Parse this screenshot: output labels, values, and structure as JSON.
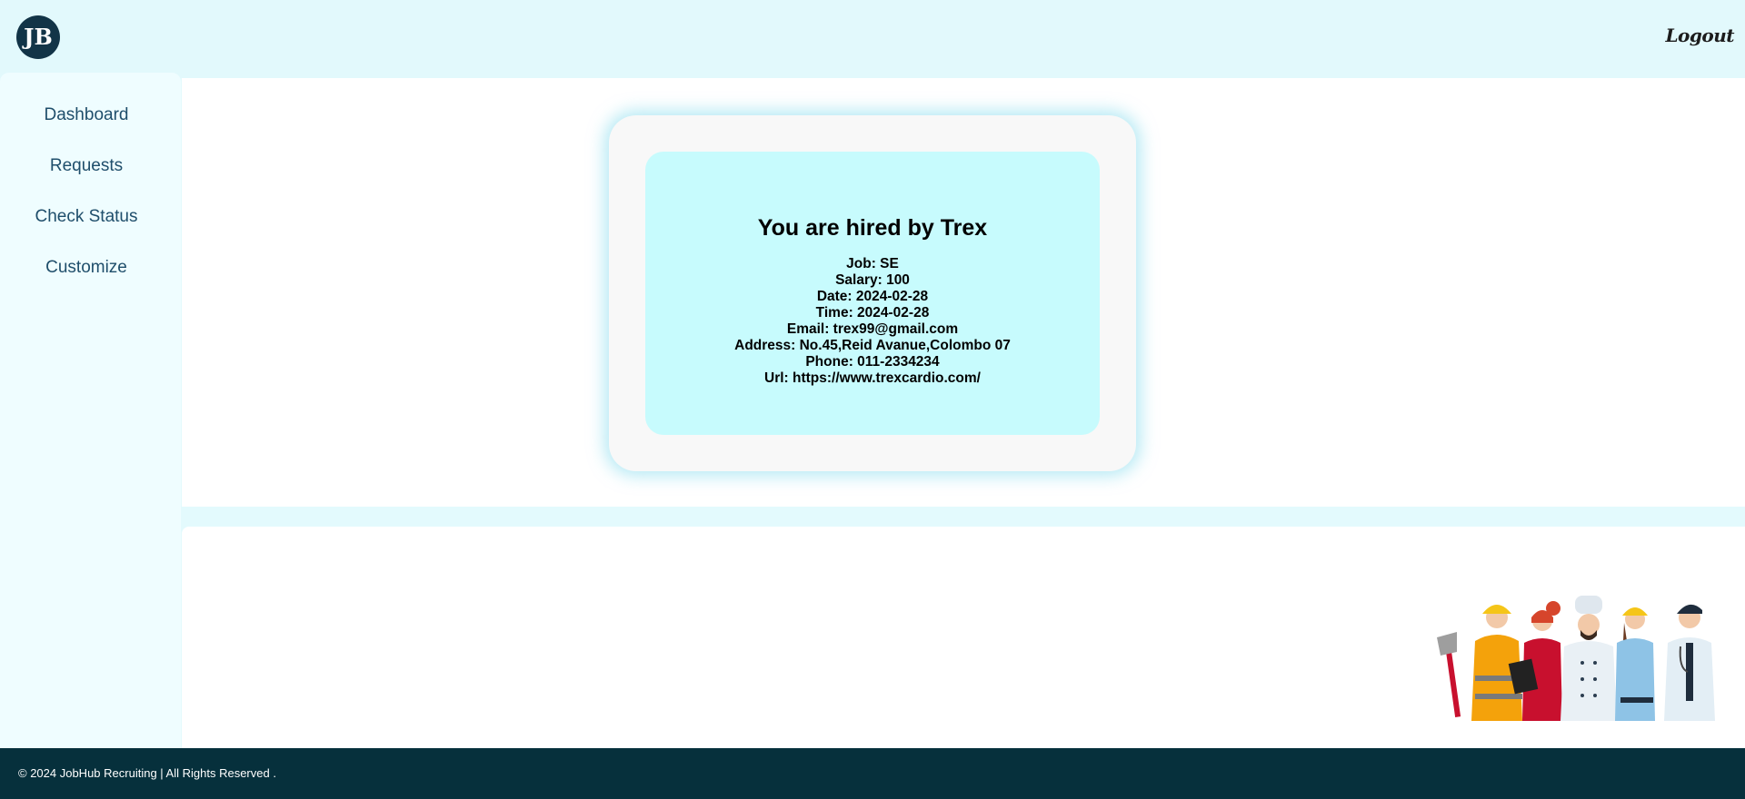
{
  "header": {
    "logo_text": "JB",
    "logout_label": "Logout"
  },
  "sidebar": {
    "items": [
      {
        "label": "Dashboard"
      },
      {
        "label": "Requests"
      },
      {
        "label": "Check Status"
      },
      {
        "label": "Customize"
      }
    ]
  },
  "hire_card": {
    "title": "You are hired by Trex",
    "details": [
      "Job: SE",
      "Salary: 100",
      "Date: 2024-02-28",
      "Time: 2024-02-28",
      "Email: trex99@gmail.com",
      "Address: No.45,Reid Avanue,Colombo 07",
      "Phone: 011-2334234",
      "Url: https://www.trexcardio.com/"
    ]
  },
  "illustration": {
    "icon": "workers-group-illustration"
  },
  "footer": {
    "text": "© 2024 JobHub Recruiting | All Rights Reserved ."
  },
  "colors": {
    "header_bg": "#e2f9fc",
    "sidebar_bg": "#effdff",
    "nav_text": "#1f4e6b",
    "card_outer": "#f8f8f8",
    "card_inner": "#c7fbfd",
    "footer_bg": "#06303c",
    "logo_bg": "#123447"
  }
}
